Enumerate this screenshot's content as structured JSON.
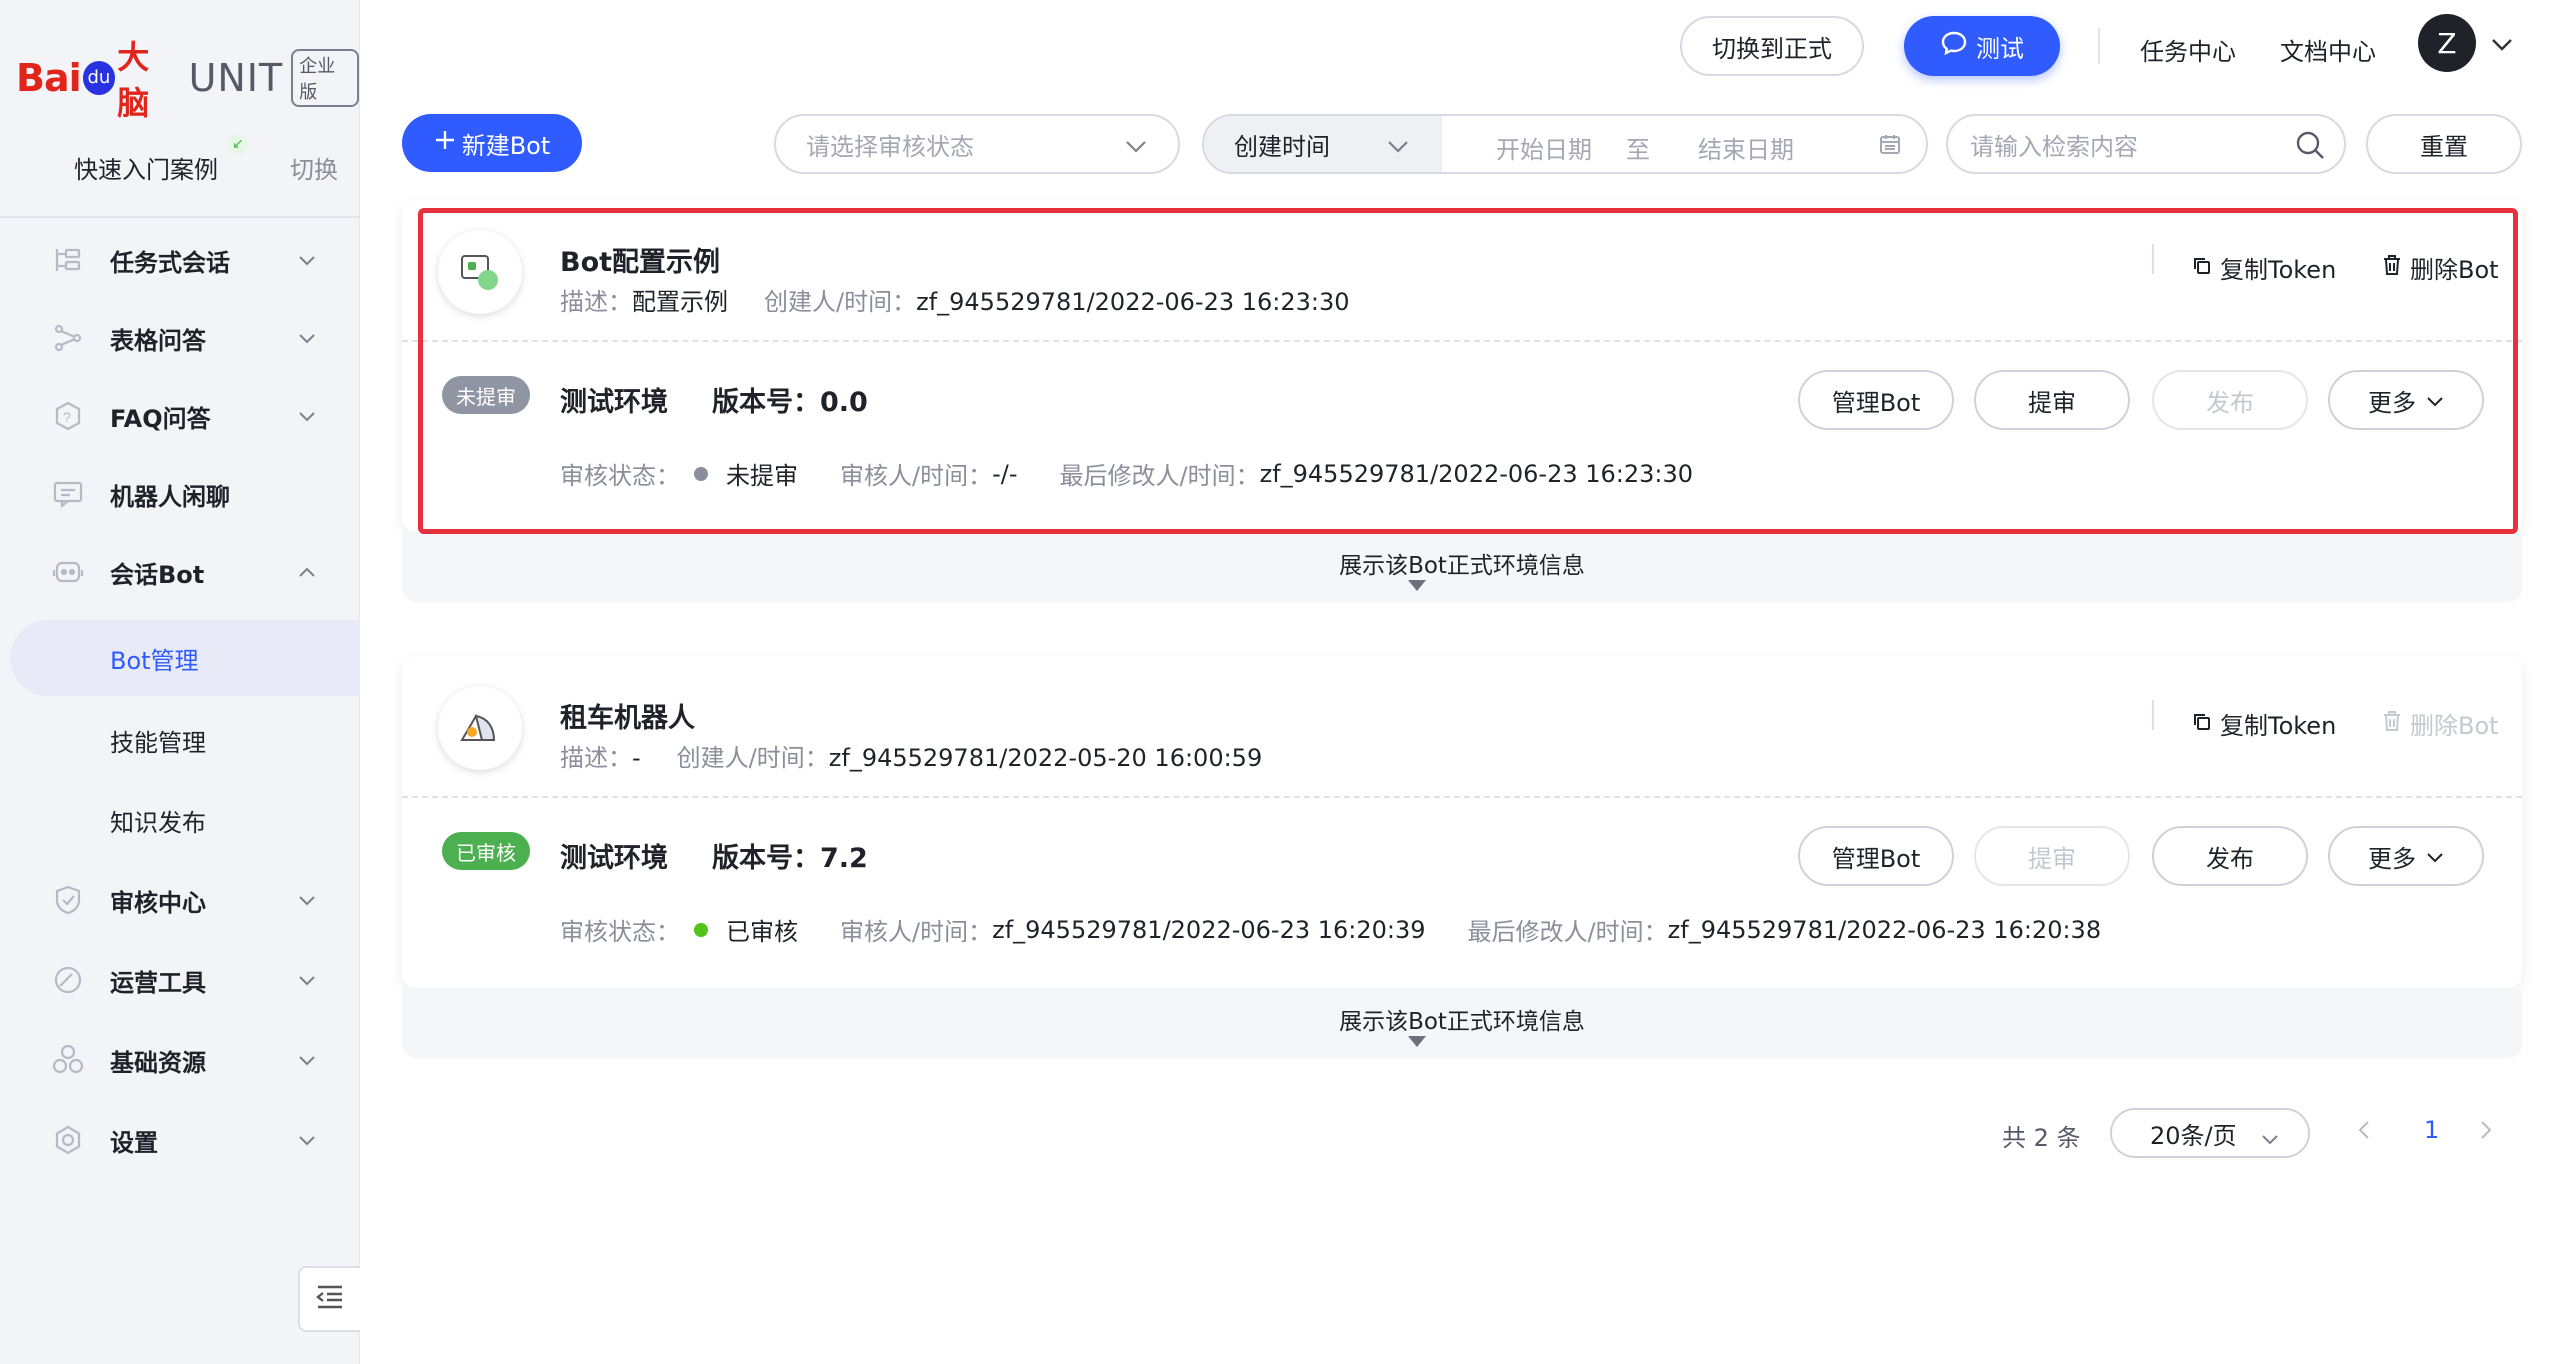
{
  "brand": {
    "baidu": "Bai",
    "paw": "du",
    "brain": "大脑",
    "unit": "UNIT",
    "edition": "企业版"
  },
  "sidebar": {
    "quick_start": "快速入门案例",
    "switch": "切换",
    "items": [
      {
        "label": "任务式会话"
      },
      {
        "label": "表格问答"
      },
      {
        "label": "FAQ问答"
      },
      {
        "label": "机器人闲聊"
      },
      {
        "label": "会话Bot"
      },
      {
        "label": "Bot管理"
      },
      {
        "label": "技能管理"
      },
      {
        "label": "知识发布"
      },
      {
        "label": "审核中心"
      },
      {
        "label": "运营工具"
      },
      {
        "label": "基础资源"
      },
      {
        "label": "设置"
      }
    ]
  },
  "topbar": {
    "switch_formal": "切换到正式",
    "test": "测试",
    "task_center": "任务中心",
    "doc_center": "文档中心",
    "avatar": "Z"
  },
  "filters": {
    "new_bot": "新建Bot",
    "review_status_placeholder": "请选择审核状态",
    "date_type": "创建时间",
    "start_date": "开始日期",
    "to": "至",
    "end_date": "结束日期",
    "search_placeholder": "请输入检索内容",
    "reset": "重置"
  },
  "labels": {
    "desc": "描述：",
    "creator_time": "创建人/时间：",
    "copy_token": "复制Token",
    "delete_bot": "删除Bot",
    "env": "测试环境",
    "version": "版本号：",
    "review_status": "审核状态：",
    "reviewer_time": "审核人/时间：",
    "modifier_time": "最后修改人/时间：",
    "manage_bot": "管理Bot",
    "submit_review": "提审",
    "publish": "发布",
    "more": "更多",
    "expand_info": "展示该Bot正式环境信息"
  },
  "bots": [
    {
      "name": "Bot配置示例",
      "description": "配置示例",
      "creator_time": "zf_945529781/2022-06-23 16:23:30",
      "badge": "未提审",
      "badge_color": "#8f95a3",
      "version": "0.0",
      "review_status": "未提审",
      "status_color": "#8a8f99",
      "reviewer_time": "-/-",
      "modifier_time": "zf_945529781/2022-06-23 16:23:30"
    },
    {
      "name": "租车机器人",
      "description": "-",
      "creator_time": "zf_945529781/2022-05-20 16:00:59",
      "badge": "已审核",
      "badge_color": "#4caf50",
      "version": "7.2",
      "review_status": "已审核",
      "status_color": "#52c41a",
      "reviewer_time": "zf_945529781/2022-06-23 16:20:39",
      "modifier_time": "zf_945529781/2022-06-23 16:20:38"
    }
  ],
  "pagination": {
    "total": "共 2 条",
    "page_size": "20条/页",
    "current_page": "1"
  }
}
